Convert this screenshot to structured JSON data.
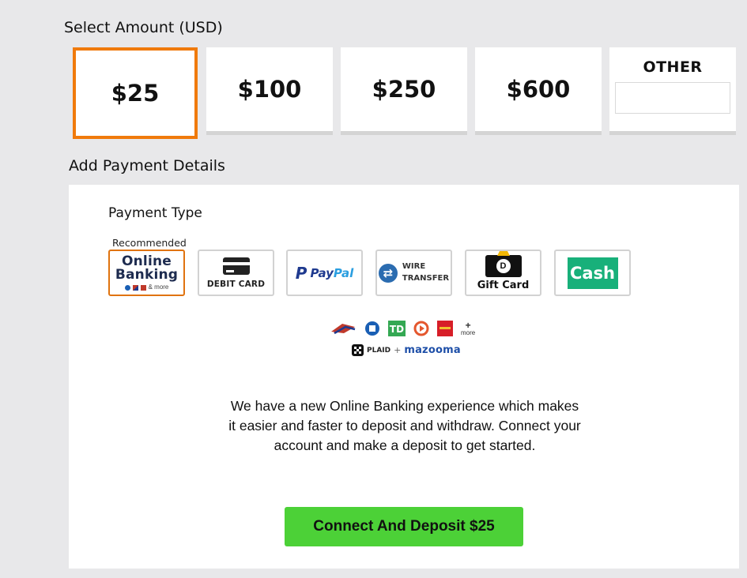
{
  "amount": {
    "title": "Select Amount (USD)",
    "options": [
      {
        "label": "$25",
        "selected": true
      },
      {
        "label": "$100",
        "selected": false
      },
      {
        "label": "$250",
        "selected": false
      },
      {
        "label": "$600",
        "selected": false
      }
    ],
    "other_label": "OTHER",
    "other_value": "",
    "selected_color": "#f07a0c"
  },
  "payment": {
    "title": "Add Payment Details",
    "type_title": "Payment Type",
    "recommended_label": "Recommended",
    "methods": {
      "online_banking": {
        "line1": "Online",
        "line2": "Banking",
        "more": "& more",
        "selected": true
      },
      "debit_card": {
        "label": "DEBIT CARD",
        "icon": "credit-card-icon"
      },
      "paypal": {
        "p": "P",
        "part1": "Pay",
        "part2": "Pal",
        "icon": "paypal-logo"
      },
      "wire": {
        "line1": "WIRE",
        "line2": "TRANSFER",
        "icon": "transfer-arrows-icon"
      },
      "gift_card": {
        "label": "Gift Card",
        "badge": "D",
        "icon": "draftkings-gift-card-icon"
      },
      "cash": {
        "label": "Cash",
        "color": "#18b07a"
      }
    },
    "banks": {
      "icons": [
        "bank-of-america-icon",
        "chase-icon",
        "td-bank-icon",
        "citizens-icon",
        "wells-fargo-icon"
      ],
      "more_label": "more",
      "plaid_label": "PLAID",
      "plus": "+",
      "mazooma_label": "mazooma"
    },
    "description": "We have a new Online Banking experience which makes it easier and faster to deposit and withdraw. Connect your account and make a deposit to get started.",
    "cta_label": "Connect And Deposit $25",
    "cta_color": "#4cd137"
  }
}
